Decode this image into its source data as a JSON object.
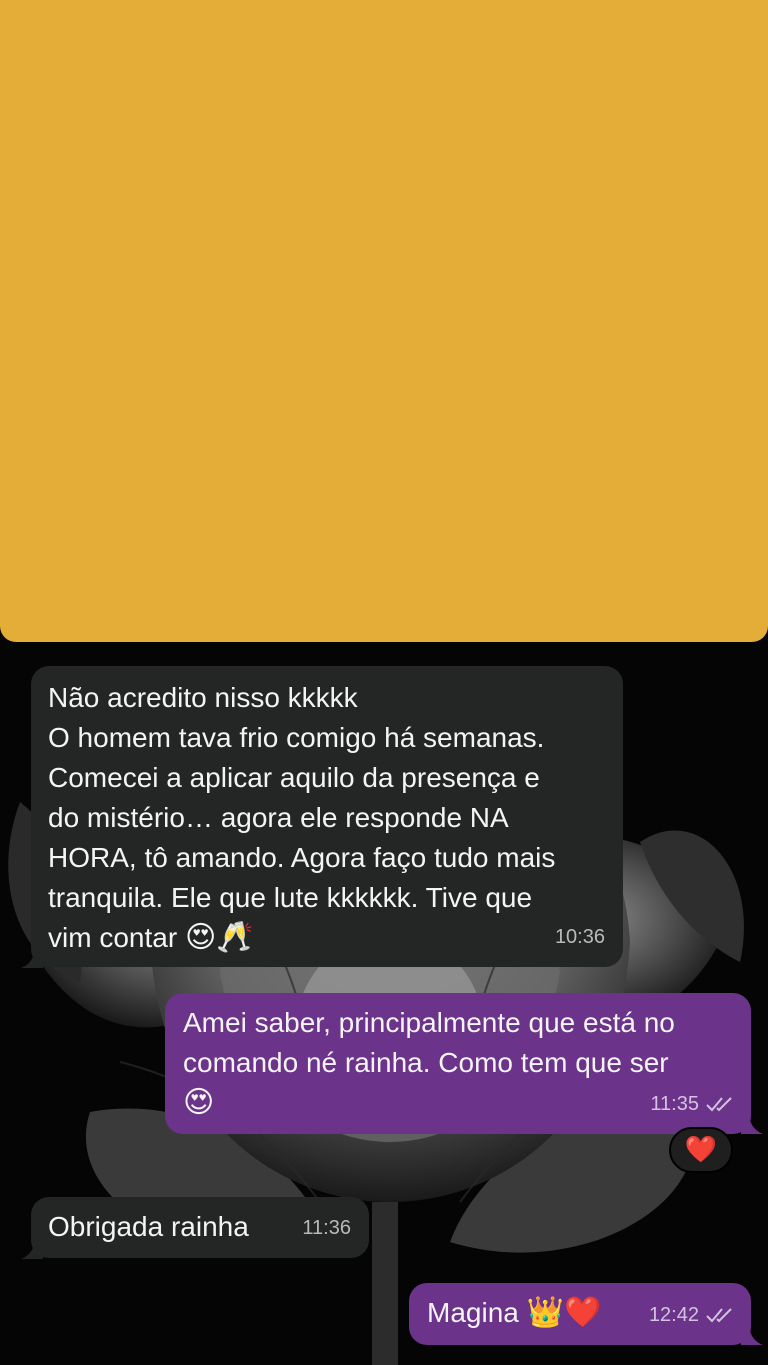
{
  "cover": {
    "color": "#E3AD37"
  },
  "colors": {
    "incoming_bubble": "#242626",
    "outgoing_bubble": "#6B3389",
    "text": "#F4F4F4"
  },
  "messages": [
    {
      "direction": "incoming",
      "text": "Não acredito nisso kkkkk\nO homem tava frio comigo há semanas.\nComecei a aplicar aquilo da presença e\ndo mistério… agora ele responde NA\nHORA, tô amando. Agora faço tudo mais\ntranquila. Ele que lute kkkkkk. Tive que\nvim contar",
      "emojis": "😍🥂",
      "time": "10:36"
    },
    {
      "direction": "outgoing",
      "text": "Amei saber, principalmente que está no\ncomando né rainha. Como tem que ser",
      "emojis": "😍",
      "time": "11:35",
      "status": "read-ticks-icon",
      "reaction": "❤️"
    },
    {
      "direction": "incoming",
      "text": "Obrigada rainha",
      "time": "11:36"
    },
    {
      "direction": "outgoing",
      "text": "Magina",
      "emojis": "👑❤️",
      "time": "12:42",
      "status": "read-ticks-icon"
    }
  ]
}
